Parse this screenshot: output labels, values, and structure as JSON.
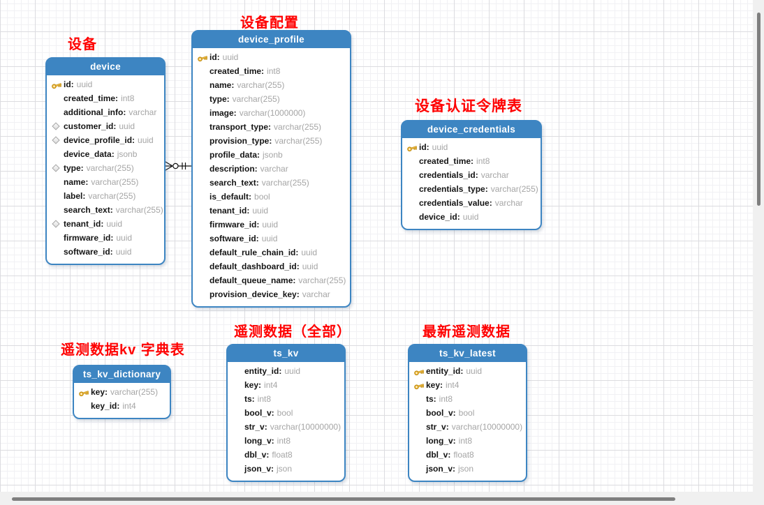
{
  "colors": {
    "table_accent": "#3d85c2",
    "caption_red": "#ff0000",
    "canvas_bg": "#ffffff",
    "grid_minor": "#f1f1f4",
    "grid_major": "#dcdce0",
    "scrollbar_track": "#f0f0f0",
    "scrollbar_thumb": "#7f7f7f",
    "column_type_gray": "#a5a5a5"
  },
  "tables": [
    {
      "name": "device",
      "caption": "设备",
      "columns": [
        {
          "icon": "key",
          "name": "id",
          "type": "uuid"
        },
        {
          "icon": null,
          "name": "created_time",
          "type": "int8"
        },
        {
          "icon": null,
          "name": "additional_info",
          "type": "varchar"
        },
        {
          "icon": "diamond",
          "name": "customer_id",
          "type": "uuid"
        },
        {
          "icon": "diamond",
          "name": "device_profile_id",
          "type": "uuid"
        },
        {
          "icon": null,
          "name": "device_data",
          "type": "jsonb"
        },
        {
          "icon": "diamond",
          "name": "type",
          "type": "varchar(255)"
        },
        {
          "icon": null,
          "name": "name",
          "type": "varchar(255)"
        },
        {
          "icon": null,
          "name": "label",
          "type": "varchar(255)"
        },
        {
          "icon": null,
          "name": "search_text",
          "type": "varchar(255)"
        },
        {
          "icon": "diamond",
          "name": "tenant_id",
          "type": "uuid"
        },
        {
          "icon": null,
          "name": "firmware_id",
          "type": "uuid"
        },
        {
          "icon": null,
          "name": "software_id",
          "type": "uuid"
        }
      ]
    },
    {
      "name": "device_profile",
      "caption": "设备配置",
      "columns": [
        {
          "icon": "key",
          "name": "id",
          "type": "uuid"
        },
        {
          "icon": null,
          "name": "created_time",
          "type": "int8"
        },
        {
          "icon": null,
          "name": "name",
          "type": "varchar(255)"
        },
        {
          "icon": null,
          "name": "type",
          "type": "varchar(255)"
        },
        {
          "icon": null,
          "name": "image",
          "type": "varchar(1000000)"
        },
        {
          "icon": null,
          "name": "transport_type",
          "type": "varchar(255)"
        },
        {
          "icon": null,
          "name": "provision_type",
          "type": "varchar(255)"
        },
        {
          "icon": null,
          "name": "profile_data",
          "type": "jsonb"
        },
        {
          "icon": null,
          "name": "description",
          "type": "varchar"
        },
        {
          "icon": null,
          "name": "search_text",
          "type": "varchar(255)"
        },
        {
          "icon": null,
          "name": "is_default",
          "type": "bool"
        },
        {
          "icon": null,
          "name": "tenant_id",
          "type": "uuid"
        },
        {
          "icon": null,
          "name": "firmware_id",
          "type": "uuid"
        },
        {
          "icon": null,
          "name": "software_id",
          "type": "uuid"
        },
        {
          "icon": null,
          "name": "default_rule_chain_id",
          "type": "uuid"
        },
        {
          "icon": null,
          "name": "default_dashboard_id",
          "type": "uuid"
        },
        {
          "icon": null,
          "name": "default_queue_name",
          "type": "varchar(255)"
        },
        {
          "icon": null,
          "name": "provision_device_key",
          "type": "varchar"
        }
      ]
    },
    {
      "name": "device_credentials",
      "caption": "设备认证令牌表",
      "columns": [
        {
          "icon": "key",
          "name": "id",
          "type": "uuid"
        },
        {
          "icon": null,
          "name": "created_time",
          "type": "int8"
        },
        {
          "icon": null,
          "name": "credentials_id",
          "type": "varchar"
        },
        {
          "icon": null,
          "name": "credentials_type",
          "type": "varchar(255)"
        },
        {
          "icon": null,
          "name": "credentials_value",
          "type": "varchar"
        },
        {
          "icon": null,
          "name": "device_id",
          "type": "uuid"
        }
      ]
    },
    {
      "name": "ts_kv",
      "caption": "遥测数据（全部）",
      "columns": [
        {
          "icon": null,
          "name": "entity_id",
          "type": "uuid"
        },
        {
          "icon": null,
          "name": "key",
          "type": "int4"
        },
        {
          "icon": null,
          "name": "ts",
          "type": "int8"
        },
        {
          "icon": null,
          "name": "bool_v",
          "type": "bool"
        },
        {
          "icon": null,
          "name": "str_v",
          "type": "varchar(10000000)"
        },
        {
          "icon": null,
          "name": "long_v",
          "type": "int8"
        },
        {
          "icon": null,
          "name": "dbl_v",
          "type": "float8"
        },
        {
          "icon": null,
          "name": "json_v",
          "type": "json"
        }
      ]
    },
    {
      "name": "ts_kv_latest",
      "caption": "最新遥测数据",
      "columns": [
        {
          "icon": "key",
          "name": "entity_id",
          "type": "uuid"
        },
        {
          "icon": "key",
          "name": "key",
          "type": "int4"
        },
        {
          "icon": null,
          "name": "ts",
          "type": "int8"
        },
        {
          "icon": null,
          "name": "bool_v",
          "type": "bool"
        },
        {
          "icon": null,
          "name": "str_v",
          "type": "varchar(10000000)"
        },
        {
          "icon": null,
          "name": "long_v",
          "type": "int8"
        },
        {
          "icon": null,
          "name": "dbl_v",
          "type": "float8"
        },
        {
          "icon": null,
          "name": "json_v",
          "type": "json"
        }
      ]
    },
    {
      "name": "ts_kv_dictionary",
      "caption": "遥测数据kv 字典表",
      "columns": [
        {
          "icon": "key",
          "name": "key",
          "type": "varchar(255)"
        },
        {
          "icon": null,
          "name": "key_id",
          "type": "int4"
        }
      ]
    }
  ],
  "relationship": {
    "from": "device",
    "to": "device_profile",
    "from_cardinality": "zero-or-many",
    "to_cardinality": "one-and-only-one"
  }
}
